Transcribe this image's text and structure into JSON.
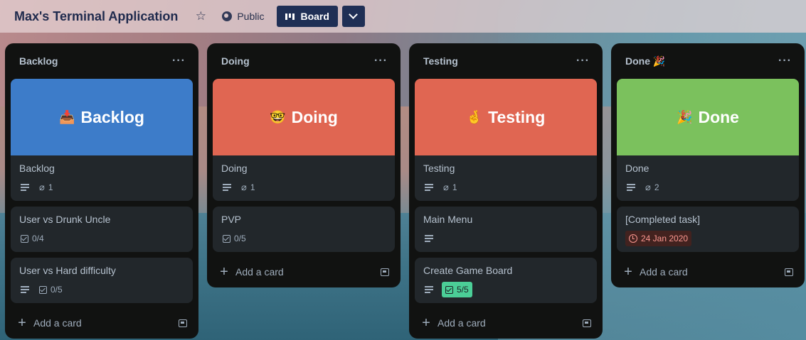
{
  "header": {
    "title": "Max's Terminal Application",
    "star_icon": "star-icon",
    "visibility_label": "Public",
    "view_label": "Board"
  },
  "colors": {
    "backlog_cover": "#3d7cc9",
    "doing_cover": "#e06652",
    "testing_cover": "#e06652",
    "done_cover": "#7bc15d",
    "checklist_complete": "#4bce97",
    "due_overdue": "#42221f"
  },
  "lists": {
    "backlog": {
      "title": "Backlog",
      "cover_emoji": "📥",
      "cover_text": "Backlog",
      "cards": [
        {
          "title": "Backlog",
          "attachments": "1"
        },
        {
          "title": "User vs Drunk Uncle",
          "checklist": "0/4"
        },
        {
          "title": "User vs Hard difficulty",
          "checklist": "0/5"
        }
      ],
      "add_label": "Add a card"
    },
    "doing": {
      "title": "Doing",
      "cover_emoji": "🤓",
      "cover_text": "Doing",
      "cards": [
        {
          "title": "Doing",
          "attachments": "1"
        },
        {
          "title": "PVP",
          "checklist": "0/5"
        }
      ],
      "add_label": "Add a card"
    },
    "testing": {
      "title": "Testing",
      "cover_emoji": "🤞",
      "cover_text": "Testing",
      "cards": [
        {
          "title": "Testing",
          "attachments": "1"
        },
        {
          "title": "Main Menu"
        },
        {
          "title": "Create Game Board",
          "checklist": "5/5"
        }
      ],
      "add_label": "Add a card"
    },
    "done": {
      "title": "Done 🎉",
      "cover_emoji": "🎉",
      "cover_text": "Done",
      "cards": [
        {
          "title": "Done",
          "attachments": "2"
        },
        {
          "title": "[Completed task]",
          "due": "24 Jan 2020"
        }
      ],
      "add_label": "Add a card"
    }
  }
}
